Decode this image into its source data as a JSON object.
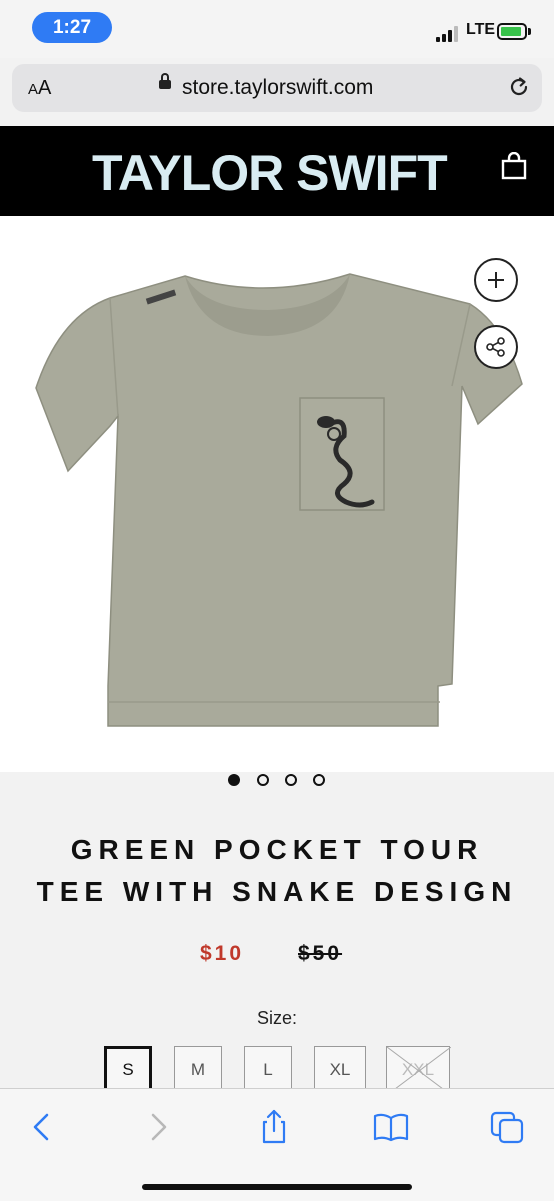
{
  "status_bar": {
    "time": "1:27",
    "network": "LTE"
  },
  "browser": {
    "text_size_label": "AA",
    "url": "store.taylorswift.com"
  },
  "site": {
    "brand": "TAYLOR SWIFT"
  },
  "product": {
    "title_line1": "GREEN POCKET TOUR",
    "title_line2": "TEE WITH SNAKE DESIGN",
    "sale_price": "$10",
    "original_price": "$50",
    "size_label": "Size:",
    "sizes": [
      {
        "label": "S",
        "selected": true,
        "available": true
      },
      {
        "label": "M",
        "selected": false,
        "available": true
      },
      {
        "label": "L",
        "selected": false,
        "available": true
      },
      {
        "label": "XL",
        "selected": false,
        "available": true
      },
      {
        "label": "XXL",
        "selected": false,
        "available": false
      }
    ],
    "image_count": 4,
    "active_image": 1
  },
  "colors": {
    "accent": "#2f7bf4",
    "sale_red": "#c0392b",
    "shirt": "#a9aa9b"
  },
  "toolbar": {
    "icons": [
      "back-icon",
      "forward-icon",
      "share-icon",
      "bookmarks-icon",
      "tabs-icon"
    ]
  }
}
